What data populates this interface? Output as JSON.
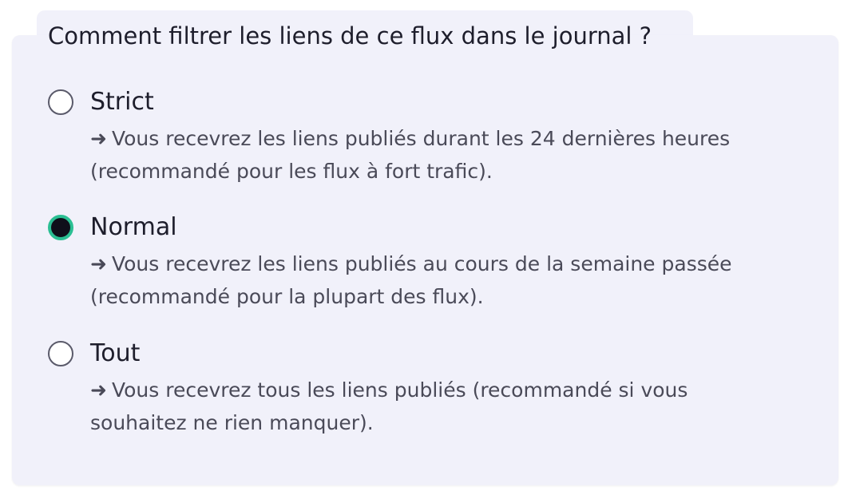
{
  "question": "Comment filtrer les liens de ce flux dans le journal ?",
  "arrow_glyph": "➜",
  "options": [
    {
      "label": "Strict",
      "checked": false,
      "desc_line1": "Vous recevrez les liens publiés durant les 24 dernières heures",
      "desc_line2": "(recommandé pour les flux à fort trafic)."
    },
    {
      "label": "Normal",
      "checked": true,
      "desc_line1": "Vous recevrez les liens publiés au cours de la semaine passée",
      "desc_line2": "(recommandé pour la plupart des flux)."
    },
    {
      "label": "Tout",
      "checked": false,
      "desc_line1": "Vous recevrez tous les liens publiés (recommandé si vous",
      "desc_line2": "souhaitez ne rien manquer)."
    }
  ],
  "colors": {
    "panel_bg": "#f1f1fa",
    "radio_checked_ring": "#2bbf93",
    "radio_checked_dot": "#0f0f1a",
    "description_text": "#4a4a58"
  }
}
